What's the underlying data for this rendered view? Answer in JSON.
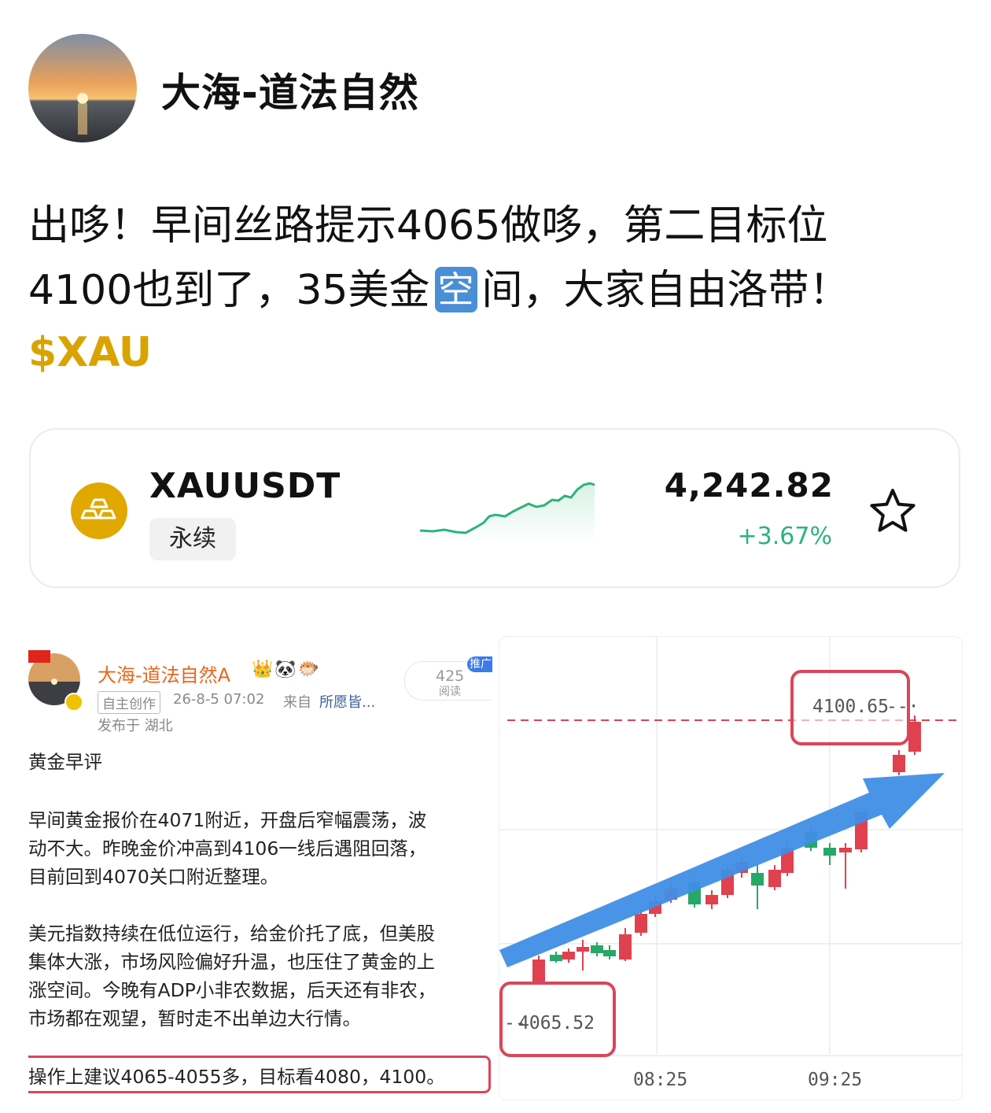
{
  "author": {
    "name": "大海-道法自然"
  },
  "post": {
    "line1": "出哆！早间丝路提示4065做哆，第二目标位",
    "line2_pre": "4100也到了，35美金",
    "emoji": "空",
    "line2_post": "间，大家自由洛带！",
    "tag": "$XAU"
  },
  "ticker": {
    "symbol": "XAUUSDT",
    "type": "永续",
    "price": "4,242.82",
    "change": "+3.67%",
    "icon": "gold-bars-icon",
    "favorite_icon": "star-outline-icon",
    "colors": {
      "up": "#2db37a",
      "coin": "#e0a800"
    }
  },
  "embedded_post": {
    "name": "大海-道法自然A",
    "emojis": "👑🐼🐡",
    "origin": "自主创作",
    "time": "26-8-5 07:02",
    "source_prefix": "来自",
    "source": "所愿皆...",
    "location": "发布于 湖北",
    "reads": "425",
    "reads_label": "阅读",
    "promo": "推广",
    "heading": "黄金早评",
    "para1": [
      "早间黄金报价在4071附近，开盘后窄幅震荡，波",
      "动不大。昨晚金价冲高到4106一线后遇阻回落，",
      "目前回到4070关口附近整理。"
    ],
    "para2": [
      "美元指数持续在低位运行，给金价托了底，但美股",
      "集体大涨，市场风险偏好升温，也压住了黄金的上",
      "涨空间。今晚有ADP小非农数据，后天还有非农，",
      "市场都在观望，暂时走不出单边大行情。"
    ],
    "advice": "操作上建议4065-4055多，目标看4080，4100。"
  },
  "chart": {
    "high_label": "4100.65",
    "low_label": "4065.52",
    "x_labels": [
      "08:25",
      "09:25"
    ],
    "colors": {
      "up": "#e0414f",
      "down": "#27a768",
      "arrow": "#3f8ee6",
      "box": "#d9465a"
    }
  }
}
